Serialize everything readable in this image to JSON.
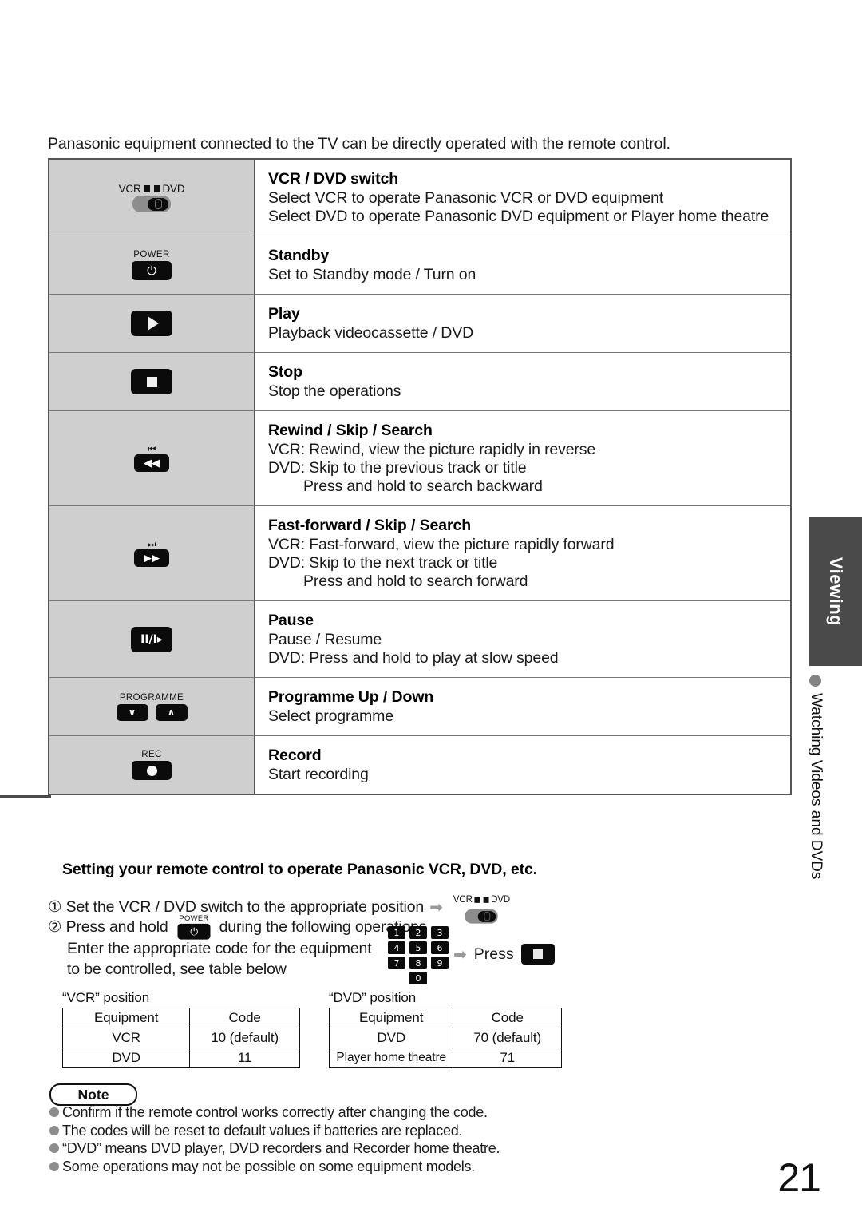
{
  "intro": "Panasonic equipment connected to the TV can be directly operated with the remote control.",
  "table": {
    "rows": [
      {
        "icon": "vcr-dvd-switch",
        "icon_labels": {
          "left": "VCR",
          "right": "DVD"
        },
        "title": "VCR / DVD switch",
        "lines": [
          {
            "text": "Select VCR to operate Panasonic VCR or DVD equipment",
            "indent": false
          },
          {
            "text": "Select DVD to operate Panasonic DVD equipment or Player home theatre",
            "indent": false
          }
        ]
      },
      {
        "icon": "power-button",
        "icon_labels": {
          "top": "POWER"
        },
        "title": "Standby",
        "lines": [
          {
            "text": "Set to Standby mode / Turn on",
            "indent": false
          }
        ]
      },
      {
        "icon": "play-button",
        "title": "Play",
        "lines": [
          {
            "text": "Playback videocassette / DVD",
            "indent": false
          }
        ]
      },
      {
        "icon": "stop-button",
        "title": "Stop",
        "lines": [
          {
            "text": "Stop the operations",
            "indent": false
          }
        ]
      },
      {
        "icon": "rewind-button",
        "title": "Rewind / Skip / Search",
        "lines": [
          {
            "text": "VCR: Rewind, view the picture rapidly in reverse",
            "indent": false
          },
          {
            "text": "DVD: Skip to the previous track or title",
            "indent": false
          },
          {
            "text": "Press and hold to search backward",
            "indent": true
          }
        ]
      },
      {
        "icon": "fast-forward-button",
        "title": "Fast-forward / Skip / Search",
        "lines": [
          {
            "text": "VCR: Fast-forward, view the picture rapidly forward",
            "indent": false
          },
          {
            "text": "DVD: Skip to the next track or title",
            "indent": false
          },
          {
            "text": "Press and hold to search forward",
            "indent": true
          }
        ]
      },
      {
        "icon": "pause-button",
        "icon_glyph": "II/I▸",
        "title": "Pause",
        "lines": [
          {
            "text": "Pause / Resume",
            "indent": false
          },
          {
            "text": "DVD: Press and hold to play at slow speed",
            "indent": false
          }
        ]
      },
      {
        "icon": "programme-buttons",
        "icon_labels": {
          "top": "PROGRAMME"
        },
        "title": "Programme Up / Down",
        "lines": [
          {
            "text": "Select programme",
            "indent": false
          }
        ]
      },
      {
        "icon": "record-button",
        "icon_labels": {
          "top": "REC"
        },
        "title": "Record",
        "lines": [
          {
            "text": "Start recording",
            "indent": false
          }
        ]
      }
    ]
  },
  "sidebar": {
    "tab_label": "Viewing",
    "section_label": "Watching Videos and DVDs"
  },
  "setup": {
    "title": "Setting your remote control to operate Panasonic VCR, DVD, etc.",
    "step1": "① Set the VCR / DVD switch to the appropriate position",
    "step2_a": "② Press and hold",
    "step2_b": "during the following operations",
    "step3_line1": "Enter the appropriate code for the equipment",
    "step3_line2": "to be controlled, see table below",
    "press_label": "Press",
    "keypad": [
      "1",
      "2",
      "3",
      "4",
      "5",
      "6",
      "7",
      "8",
      "9",
      "0"
    ]
  },
  "code_tables": [
    {
      "caption": "“VCR” position",
      "headers": [
        "Equipment",
        "Code"
      ],
      "rows": [
        [
          "VCR",
          "10 (default)"
        ],
        [
          "DVD",
          "11"
        ]
      ]
    },
    {
      "caption": "“DVD” position",
      "headers": [
        "Equipment",
        "Code"
      ],
      "rows": [
        [
          "DVD",
          "70 (default)"
        ],
        [
          "Player home theatre",
          "71"
        ]
      ]
    }
  ],
  "note": {
    "badge": "Note",
    "items": [
      "Confirm if the remote control works correctly after changing the code.",
      "The codes will be reset to default values if batteries are replaced.",
      "“DVD” means DVD player, DVD recorders and Recorder home theatre.",
      "Some operations may not be possible on some equipment models."
    ]
  },
  "page_number": "21"
}
